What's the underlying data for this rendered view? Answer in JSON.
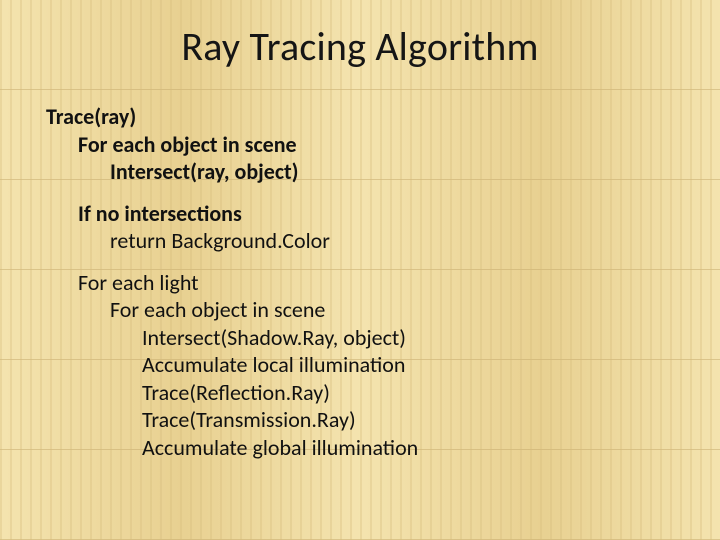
{
  "title": "Ray Tracing Algorithm",
  "code": {
    "blocks": [
      {
        "lines": [
          {
            "text": "Trace(ray)",
            "indent": 0,
            "bold": true
          },
          {
            "text": "For each object in scene",
            "indent": 1,
            "bold": true
          },
          {
            "text": "Intersect(ray, object)",
            "indent": 2,
            "bold": true
          }
        ]
      },
      {
        "lines": [
          {
            "text": "If no intersections",
            "indent": 1,
            "bold": true
          },
          {
            "text": "return Background.Color",
            "indent": 2,
            "bold": false
          }
        ]
      },
      {
        "lines": [
          {
            "text": "For each light",
            "indent": 1,
            "bold": false
          },
          {
            "text": "For each object in scene",
            "indent": 2,
            "bold": false
          },
          {
            "text": "Intersect(Shadow.Ray, object)",
            "indent": 3,
            "bold": false
          },
          {
            "text": "Accumulate local illumination",
            "indent": 3,
            "bold": false
          },
          {
            "text": "Trace(Reflection.Ray)",
            "indent": 3,
            "bold": false
          },
          {
            "text": "Trace(Transmission.Ray)",
            "indent": 3,
            "bold": false
          },
          {
            "text": "Accumulate global illumination",
            "indent": 3,
            "bold": false
          }
        ]
      }
    ]
  }
}
